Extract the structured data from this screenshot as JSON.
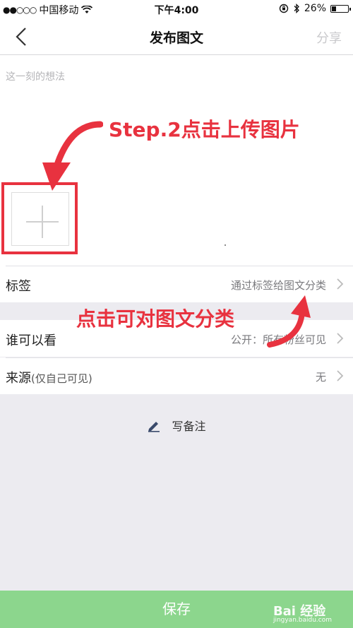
{
  "status_bar": {
    "signal": "●●○○○",
    "carrier": "中国移动",
    "time": "下午4:00",
    "battery_percent": "26%",
    "battery_level": 0.26
  },
  "nav": {
    "title": "发布图文",
    "share_label": "分享"
  },
  "editor": {
    "placeholder": "这一刻的想法"
  },
  "rows": {
    "tag": {
      "label": "标签",
      "value": "通过标签给图文分类"
    },
    "visibility": {
      "label": "谁可以看",
      "value": "公开：所有粉丝可见"
    },
    "source": {
      "label": "来源",
      "sublabel": "(仅自己可见)",
      "value": "无"
    }
  },
  "note": {
    "label": "写备注"
  },
  "save": {
    "label": "保存"
  },
  "annotations": {
    "step2": "Step.2点击上传图片",
    "classify": "点击可对图文分类"
  },
  "watermark": {
    "brand": "Bai 经验",
    "url": "jingyan.baidu.com"
  },
  "colors": {
    "annotation_red": "#e8323f",
    "save_green": "#8cd68d",
    "page_bg": "#ecebf0"
  }
}
